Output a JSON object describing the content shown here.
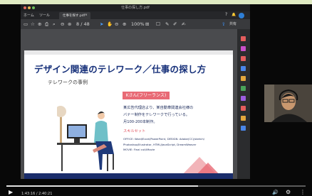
{
  "window": {
    "title": "仕事の探し方.pdf",
    "menu": [
      "ホーム",
      "ツール"
    ],
    "file_tab": "仕事を探す.pdf",
    "file_tab_close": "×",
    "help": "?",
    "bell": "🔔"
  },
  "toolbar": {
    "page_display": "8 / 48",
    "zoom": "100%",
    "share_label": "共有"
  },
  "slide": {
    "title": "デザイン関連のテレワーク／仕事の探し方",
    "subtitle": "テレワークの事例",
    "name_badge": "Kさん(フリーランス)",
    "desc_lines": [
      "某広告代理店より、某自動車関連会社様の",
      "バナー制作をテレワークで行っている。",
      "月100-200本制作。"
    ],
    "skill_heading": "スキルセット",
    "skill_lines": [
      "OFFICE: Word/Excel/PowerPoint, DESIGN: Adobe(CC)/sketch/",
      "Photoshop/Illustrator, HTML/JavaScript, DreamWeaver",
      "MOVIE: Final cut/iMovie"
    ]
  },
  "player": {
    "time": "1:43:16 / 2:40:21",
    "progress": 0.64,
    "play_icon": "play-icon",
    "volume_icon": "volume-icon",
    "settings_icon": "settings-icon",
    "more_icon": "more-icon"
  },
  "colors": {
    "title_blue": "#16307a",
    "badge_red": "#e86a75",
    "skill_red": "#e0505c",
    "band_navy": "#1a2d6b",
    "top_strip": "#dfeac2"
  }
}
